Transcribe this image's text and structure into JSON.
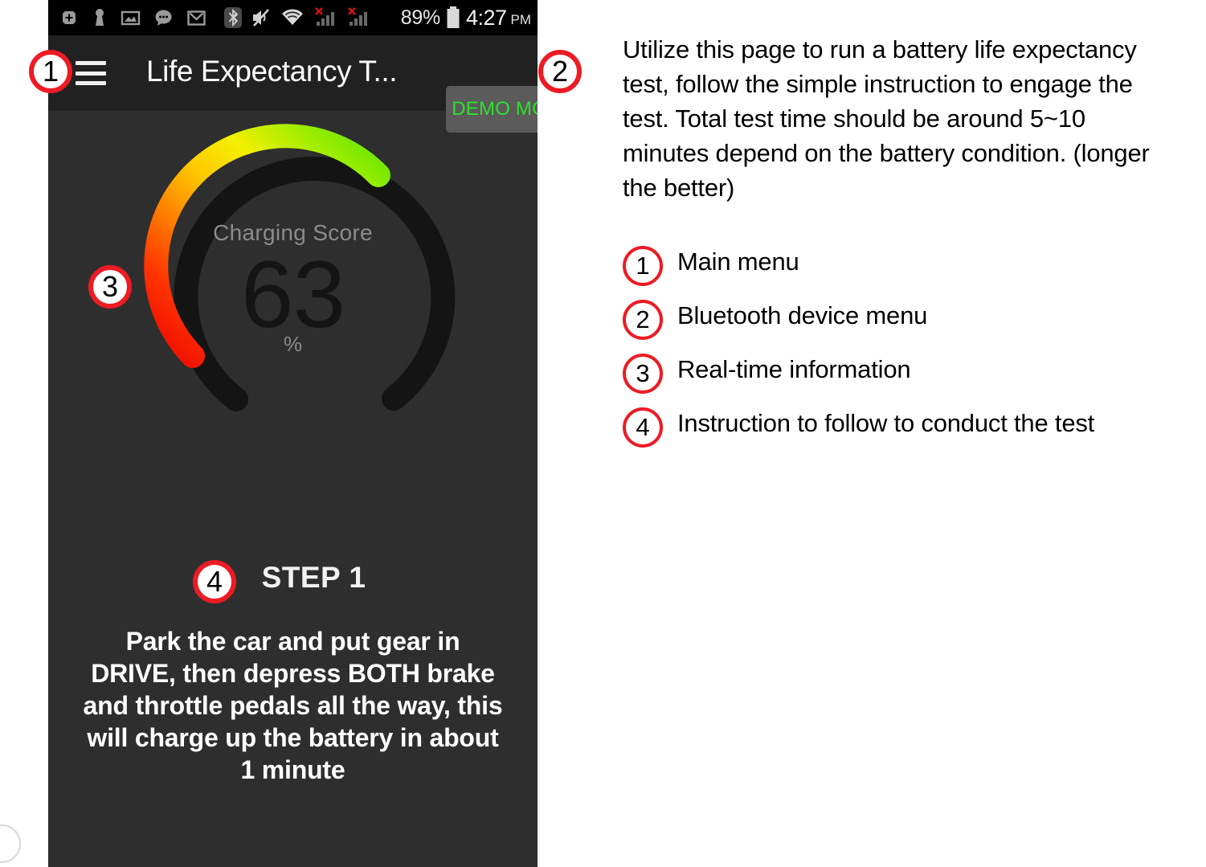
{
  "phone": {
    "status_bar": {
      "icons": [
        "app-install-icon",
        "key-icon",
        "gallery-icon",
        "message-bubble-icon",
        "gmail-icon",
        "bluetooth-icon",
        "mute-icon",
        "wifi-icon",
        "signal-1-no-service-icon",
        "signal-2-no-service-icon"
      ],
      "battery_percent": "89%",
      "battery_icon": "battery-icon",
      "time": "4:27",
      "am_pm": "PM"
    },
    "app_bar": {
      "menu_icon": "hamburger-menu-icon",
      "title": "Life Expectancy T...",
      "demo_button_label": "DEMO MODE",
      "demo_button_text_color": "#2ee02e",
      "demo_button_bg_color": "#5b5b5b"
    },
    "gauge": {
      "label": "Charging Score",
      "value": "63",
      "unit": "%",
      "percent": 63,
      "track_color": "#141414",
      "gradient_stops": [
        "#f01000",
        "#ff4a00",
        "#ff8c00",
        "#ffd200",
        "#f2f200",
        "#a8f000",
        "#5ce600"
      ]
    },
    "step": {
      "title": "STEP 1",
      "body": "Park the car and put gear in DRIVE, then depress BOTH brake and throttle pedals all the way, this will charge up the battery in about 1 minute"
    },
    "callouts": [
      {
        "number": "1"
      },
      {
        "number": "2"
      },
      {
        "number": "3"
      },
      {
        "number": "4"
      }
    ]
  },
  "annotation": {
    "intro": "Utilize this page to run a battery life expectancy test, follow the simple instruction to engage the test. Total test time should be around 5~10 minutes depend on the battery condition. (longer the better)",
    "legend": [
      {
        "number": "1",
        "text": "Main menu"
      },
      {
        "number": "2",
        "text": "Bluetooth device menu"
      },
      {
        "number": "3",
        "text": "Real-time information"
      },
      {
        "number": "4",
        "text": "Instruction to follow to conduct the test"
      }
    ]
  },
  "colors": {
    "callout_ring": "#ed1b24",
    "phone_bg": "#2e2e2e",
    "app_bar_bg": "#212121",
    "status_bar_bg": "#000000"
  }
}
